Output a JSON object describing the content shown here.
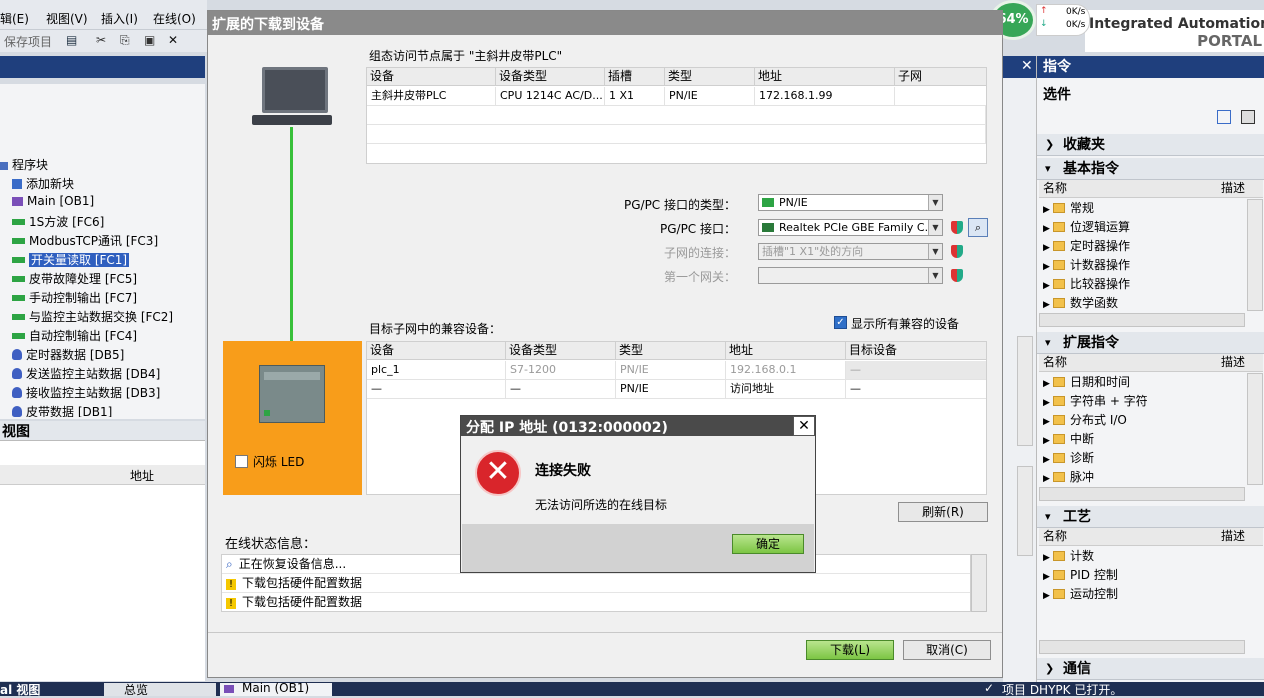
{
  "menu": {
    "items": [
      "辑(E)",
      "视图(V)",
      "插入(I)",
      "在线(O)"
    ]
  },
  "toolbar": {
    "save_project": "保存项目"
  },
  "brand": {
    "line1": "Integrated Automation",
    "line2": "PORTAL"
  },
  "network_speed": {
    "percent": "64%",
    "up": "0K/s",
    "down": "0K/s"
  },
  "project_tree": {
    "group": "程序块",
    "items": [
      {
        "label": "添加新块",
        "icon": "add-block-icon"
      },
      {
        "label": "Main [OB1]",
        "icon": "ob-icon"
      },
      {
        "label": "1S方波 [FC6]",
        "icon": "fc-icon"
      },
      {
        "label": "ModbusTCP通讯 [FC3]",
        "icon": "fc-icon"
      },
      {
        "label": "开关量读取 [FC1]",
        "icon": "fc-icon",
        "selected": true
      },
      {
        "label": "皮带故障处理 [FC5]",
        "icon": "fc-icon"
      },
      {
        "label": "手动控制输出 [FC7]",
        "icon": "fc-icon"
      },
      {
        "label": "与监控主站数据交换 [FC2]",
        "icon": "fc-icon"
      },
      {
        "label": "自动控制输出 [FC4]",
        "icon": "fc-icon"
      },
      {
        "label": "定时器数据 [DB5]",
        "icon": "db-icon"
      },
      {
        "label": "发送监控主站数据 [DB4]",
        "icon": "db-icon"
      },
      {
        "label": "接收监控主站数据 [DB3]",
        "icon": "db-icon"
      },
      {
        "label": "皮带数据 [DB1]",
        "icon": "db-icon"
      }
    ]
  },
  "detail_view": {
    "title": "视图",
    "col_address": "地址"
  },
  "taskbar": {
    "left": "al 视图",
    "tab_overview": "总览",
    "tab_main": "Main (OB1)",
    "status": "项目 DHYPK 已打开。"
  },
  "download_dialog": {
    "title": "扩展的下载到设备",
    "config_caption": "组态访问节点属于 \"主斜井皮带PLC\"",
    "config_headers": [
      "设备",
      "设备类型",
      "插槽",
      "类型",
      "地址",
      "子网"
    ],
    "config_rows": [
      [
        "主斜井皮带PLC",
        "CPU 1214C AC/D...",
        "1 X1",
        "PN/IE",
        "172.168.1.99",
        ""
      ]
    ],
    "pgpc_type_label": "PG/PC 接口的类型：",
    "pgpc_type_value": "PN/IE",
    "pgpc_if_label": "PG/PC 接口：",
    "pgpc_if_value": "Realtek PCIe GBE Family C...",
    "subnet_label": "子网的连接：",
    "subnet_value": "插槽\"1 X1\"处的方向",
    "gateway_label": "第一个网关：",
    "gateway_value": "",
    "target_caption": "目标子网中的兼容设备：",
    "show_all_label": "显示所有兼容的设备",
    "show_all_checked": true,
    "target_headers": [
      "设备",
      "设备类型",
      "类型",
      "地址",
      "目标设备"
    ],
    "target_rows": [
      [
        "plc_1",
        "S7-1200",
        "PN/IE",
        "192.168.0.1",
        "—"
      ],
      [
        "—",
        "—",
        "PN/IE",
        "访问地址",
        "—"
      ]
    ],
    "flash_led_label": "闪烁 LED",
    "refresh_button": "刷新(R)",
    "status_caption": "在线状态信息：",
    "status_lines": [
      {
        "text": "正在恢复设备信息...",
        "icon": "search-icon"
      },
      {
        "text": "下载包括硬件配置数据",
        "icon": "warning-icon"
      },
      {
        "text": "下载包括硬件配置数据",
        "icon": "warning-icon"
      }
    ],
    "download_button": "下载(L)",
    "cancel_button": "取消(C)"
  },
  "error_dialog": {
    "title": "分配 IP 地址 (0132:000002)",
    "heading": "连接失败",
    "message": "无法访问所选的在线目标",
    "ok_button": "确定"
  },
  "right_panel": {
    "title": "指令",
    "options": "选件",
    "favorites": "收藏夹",
    "basic": {
      "title": "基本指令",
      "col_name": "名称",
      "col_desc": "描述",
      "items": [
        "常规",
        "位逻辑运算",
        "定时器操作",
        "计数器操作",
        "比较器操作",
        "数学函数"
      ]
    },
    "extended": {
      "title": "扩展指令",
      "col_name": "名称",
      "col_desc": "描述",
      "items": [
        "日期和时间",
        "字符串 + 字符",
        "分布式 I/O",
        "中断",
        "诊断",
        "脉冲"
      ]
    },
    "tech": {
      "title": "工艺",
      "col_name": "名称",
      "col_desc": "描述",
      "items": [
        "计数",
        "PID 控制",
        "运动控制"
      ]
    },
    "comm": {
      "title": "通信"
    }
  }
}
